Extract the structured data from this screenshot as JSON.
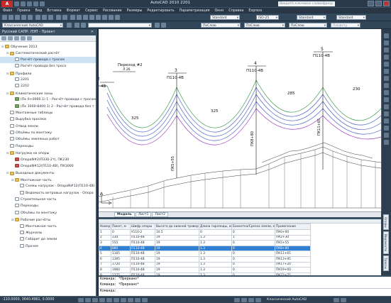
{
  "window": {
    "logo": "A",
    "title": "AutoCAD 2010    2201",
    "search_placeholder": "Введите ключевое слово/фразу"
  },
  "menu": [
    "Файл",
    "Правка",
    "Вид",
    "Вставка",
    "Формат",
    "Сервис",
    "Рисование",
    "Размеры",
    "Редактировать",
    "Параметризация",
    "Окно",
    "Справка",
    "Express"
  ],
  "toolbar": {
    "layer_combo": "Standard",
    "style_combo": "ISO-25",
    "style_combo2": "Standard",
    "style_combo3": "Standard",
    "workspace": "Классический AutoCAD",
    "color_combo": "ПоСлою",
    "linetype_combo": "ПоСлою",
    "lineweight_combo": "ПоСлою",
    "plotstyle_combo": "ПоЦвету"
  },
  "project_panel": {
    "title": "Русский САПР: ЛЭП - Проект",
    "tree": [
      {
        "label": "Обучение 2013",
        "level": 0,
        "icon": "folder"
      },
      {
        "label": "Систематический расчёт",
        "level": 1,
        "icon": "folder"
      },
      {
        "label": "Расчёт провода с тросом",
        "level": 2,
        "icon": "doc",
        "selected": true
      },
      {
        "label": "Расчёт провода без троса",
        "level": 2,
        "icon": "doc"
      },
      {
        "label": "Профили",
        "level": 1,
        "icon": "folder"
      },
      {
        "label": "2201",
        "level": 2,
        "icon": "doc"
      },
      {
        "label": "2202",
        "level": 2,
        "icon": "doc"
      },
      {
        "label": "Климатические зоны",
        "level": 1,
        "icon": "folder"
      },
      {
        "label": "(Пк 0+0000.1) 1 - Расчёт провода с тросом",
        "level": 2,
        "icon": "climate"
      },
      {
        "label": "(Пк 3000-8400.1) 2 - Расчёт провода без т",
        "level": 2,
        "icon": "climate"
      },
      {
        "label": "Монтажные таблицы",
        "level": 1,
        "icon": "doc"
      },
      {
        "label": "Вырубка просеки",
        "level": 1,
        "icon": "doc"
      },
      {
        "label": "Отвод земли",
        "level": 1,
        "icon": "doc"
      },
      {
        "label": "Объёмы по монтажу",
        "level": 1,
        "icon": "doc"
      },
      {
        "label": "Объёмы земляных работ",
        "level": 1,
        "icon": "doc"
      },
      {
        "label": "Переходы",
        "level": 1,
        "icon": "doc"
      },
      {
        "label": "Нагрузки на опоры",
        "level": 1,
        "icon": "folder"
      },
      {
        "label": "ОпораN#2(П330-2т), ПК230",
        "level": 2,
        "icon": "red"
      },
      {
        "label": "ОпораN#12(П110-4В), ПК3000",
        "level": 2,
        "icon": "red"
      },
      {
        "label": "Выходные документы",
        "level": 1,
        "icon": "folder"
      },
      {
        "label": "Монтажная часть",
        "level": 2,
        "icon": "folder"
      },
      {
        "label": "Схемы нагрузок - ОпораN#12(П110-4В)",
        "level": 3,
        "icon": "doc"
      },
      {
        "label": "Ведомость ветровых нагрузок - Опора",
        "level": 3,
        "icon": "doc"
      },
      {
        "label": "Строительная часть",
        "level": 2,
        "icon": "doc"
      },
      {
        "label": "Переходы",
        "level": 2,
        "icon": "doc"
      },
      {
        "label": "Объёмы по монтажу",
        "level": 2,
        "icon": "doc"
      },
      {
        "label": "Рабочие расчёты",
        "level": 2,
        "icon": "folder"
      },
      {
        "label": "Монтажная часть",
        "level": 3,
        "icon": "doc"
      },
      {
        "label": "Журналы",
        "level": 3,
        "icon": "doc"
      },
      {
        "label": "Габарит до земли",
        "level": 3,
        "icon": "doc"
      },
      {
        "label": "Прочее",
        "level": 3,
        "icon": "doc"
      }
    ]
  },
  "drawing": {
    "crossing_label": "Переход #2",
    "crossing_sub": "Л.26",
    "towers": [
      {
        "num": "2",
        "type": "4В"
      },
      {
        "num": "3",
        "type": "П110-4В"
      },
      {
        "num": "4",
        "type": "П110-4В"
      },
      {
        "num": "5",
        "type": "П110-4В"
      }
    ],
    "spans": [
      "325",
      "325",
      "285",
      "230"
    ],
    "pickets": [
      "ПК5+55",
      "ПК8+80",
      "ПК11+65"
    ],
    "tabs": [
      "Модель",
      "Лист1",
      "Лист2"
    ]
  },
  "table": {
    "columns": [
      "Номер",
      "Пикет, м",
      "Шифр опоры",
      "Высота до нижней траверсы, м",
      "Длина гирлянды, м",
      "Банкетка/Срезка земли, м",
      "Примечание"
    ],
    "rows": [
      [
        "1",
        "0",
        "У110-2",
        "10.5",
        "0",
        "0",
        "ПК0+00"
      ],
      [
        "2",
        "230",
        "П110-4В",
        "19",
        "1.3",
        "1",
        "ПК2+30"
      ],
      [
        "3",
        "555",
        "П110-4В",
        "19",
        "1.3",
        "0",
        "ПК5+55"
      ],
      [
        "4",
        "880",
        "П110-4В",
        "19",
        "1.3",
        "0",
        "ПК8+80"
      ],
      [
        "5",
        "1165",
        "П110-4В",
        "19",
        "1.3",
        "0",
        "ПК11+65"
      ],
      [
        "6",
        "1395",
        "П110-4В",
        "19",
        "1.3",
        "0",
        "ПК13+95"
      ],
      [
        "7",
        "1720",
        "П110-4В",
        "19",
        "1.3",
        "0",
        "ПК17+20"
      ],
      [
        "8",
        "1960",
        "П110-4В",
        "19",
        "1.3",
        "0",
        "ПК19+60"
      ],
      [
        "9",
        "2275",
        "П110-4В",
        "19",
        "1.3",
        "0",
        "ПК22+75"
      ],
      [
        "10",
        "2580",
        "П110-4В",
        "19",
        "1.3",
        "0",
        "ПК25+80"
      ]
    ],
    "highlighted_row": 3,
    "side_tabs": [
      "Опоры",
      "Ведомости",
      "Трассы"
    ]
  },
  "command": {
    "lines": [
      "Команда: *Прервано*",
      "Команда: *Прервано*"
    ],
    "prompt": "Команда:"
  },
  "statusbar": {
    "coords": "-110.0000, 3640.4961, 0.0000",
    "status_text": "Классический AutoCAD"
  }
}
